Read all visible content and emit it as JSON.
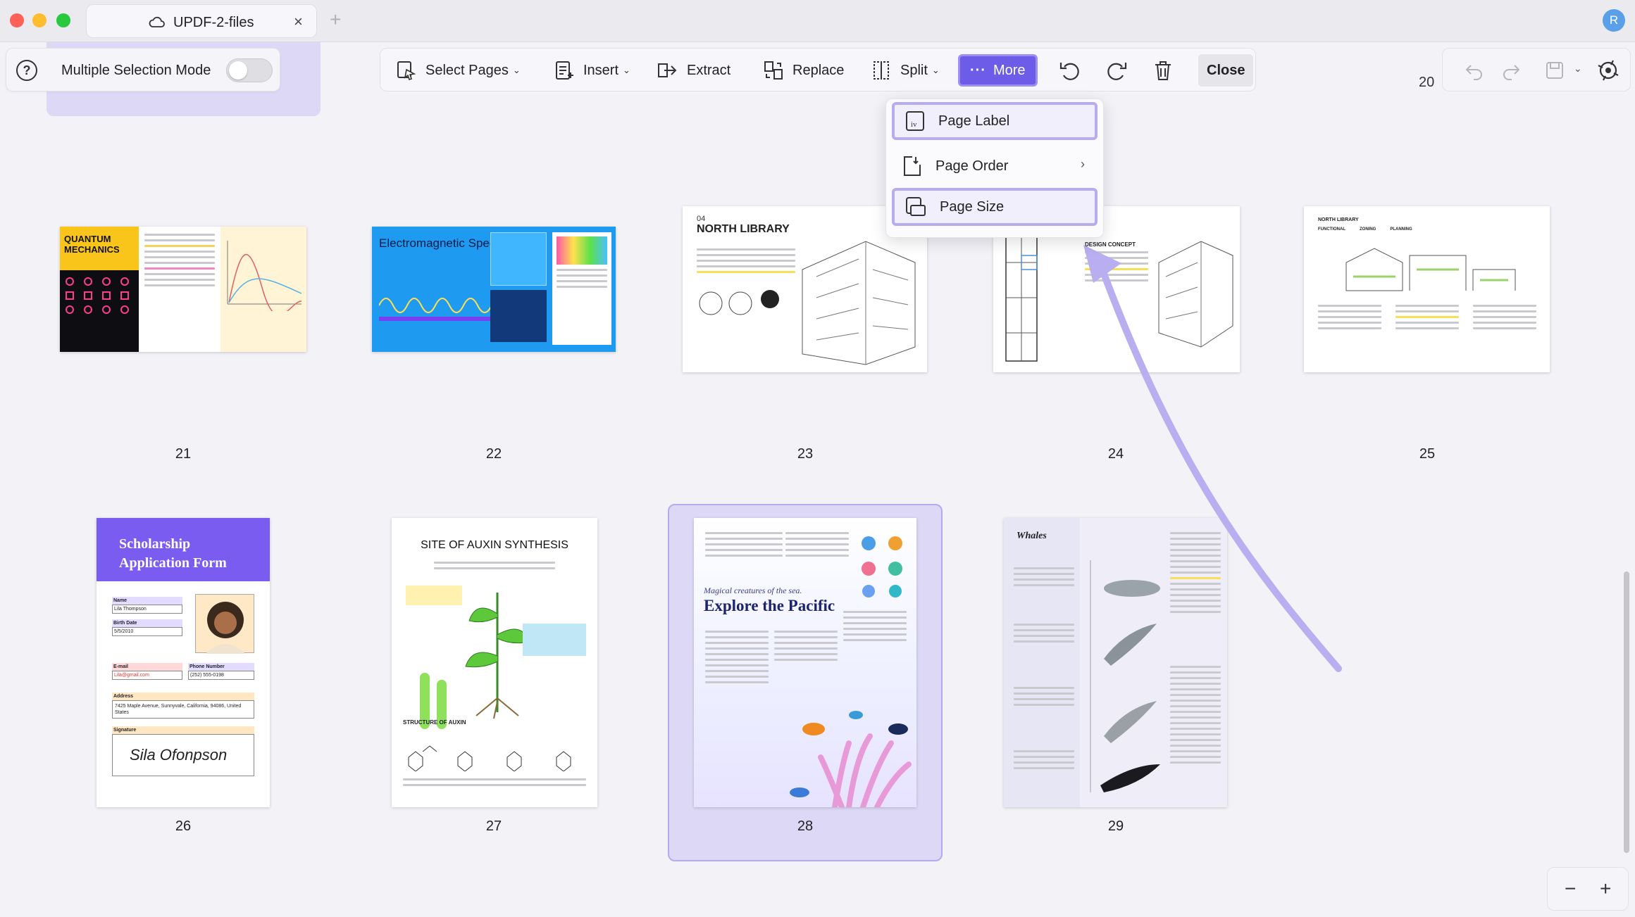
{
  "window": {
    "tab_title": "UPDF-2-files",
    "tab_close": "×",
    "tab_add": "+",
    "user_initial": "R"
  },
  "selection_panel": {
    "label": "Multiple Selection Mode",
    "help": "?",
    "toggle_on": false
  },
  "toolbar": {
    "select_pages": "Select Pages",
    "insert": "Insert",
    "extract": "Extract",
    "replace": "Replace",
    "split": "Split",
    "more": "More",
    "more_dots": "···",
    "close": "Close"
  },
  "dropdown": {
    "items": [
      {
        "label": "Page Label",
        "icon": "page-label-icon"
      },
      {
        "label": "Page Order",
        "icon": "page-order-icon",
        "submenu": "›"
      },
      {
        "label": "Page Size",
        "icon": "page-size-icon"
      }
    ]
  },
  "top_page_number": "20",
  "pages": [
    {
      "number": "21",
      "title": "QUANTUM MECHANICS"
    },
    {
      "number": "22",
      "title": "Electromagnetic Spectrum"
    },
    {
      "number": "23",
      "title": "NORTH LIBRARY",
      "subtitle": "04"
    },
    {
      "number": "24",
      "title": "DESIGN CONCEPT"
    },
    {
      "number": "25",
      "title": "NORTH LIBRARY",
      "headings": [
        "FUNCTIONAL",
        "ZONING",
        "PLANNING"
      ]
    },
    {
      "number": "26",
      "title": "Scholarship Application Form",
      "fields": {
        "name_label": "Name",
        "name": "Lila Thompson",
        "birth_label": "Birth Date",
        "birth": "5/5/2010",
        "email_label": "E-mail",
        "email": "Lila@gmail.com",
        "phone_label": "Phone Number",
        "phone": "(252) 555-0198",
        "address_label": "Address",
        "address": "7425 Maple Avenue, Sunnyvale, California, 94086, United States",
        "signature_label": "Signature",
        "signature": "Sila Ofonpson"
      }
    },
    {
      "number": "27",
      "title": "SITE OF AUXIN SYNTHESIS",
      "subheading": "STRUCTURE OF AUXIN"
    },
    {
      "number": "28",
      "title": "Explore the Pacific",
      "tagline": "Magical creatures of the sea."
    },
    {
      "number": "29",
      "title": "Whales"
    }
  ],
  "zoom": {
    "minus": "−",
    "plus": "+"
  },
  "colors": {
    "accent": "#6c5ce7",
    "selection": "#dcd8f5"
  }
}
